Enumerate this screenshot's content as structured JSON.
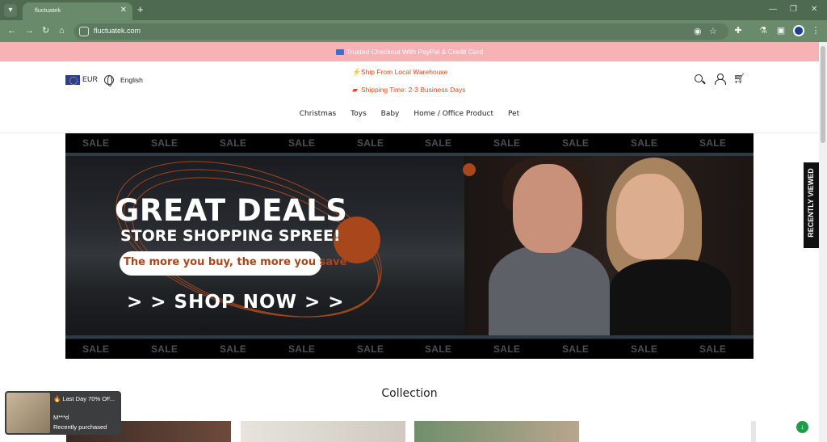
{
  "browser": {
    "tab_title": "fluctuatek",
    "url": "fluctuatek.com",
    "window_controls": [
      "—",
      "❐",
      "✕"
    ]
  },
  "store": {
    "announcement": "Trusted Checkout With PayPal & Credit Card",
    "currency": "EUR",
    "language": "English",
    "promo_lines": [
      "Ship From Local Warehouse",
      "Shipping Time: 2-3 Business Days"
    ],
    "nav": [
      "Christmas",
      "Toys",
      "Baby",
      "Home / Office Product",
      "Pet"
    ],
    "recently_viewed": "RECENTLY VIEWED"
  },
  "banner": {
    "sale_word": "SALE",
    "headline": "GREAT DEALS",
    "subheadline": "STORE SHOPPING SPREE!",
    "tagline": "The more you buy, the more you save",
    "cta": "> >  SHOP NOW  > >"
  },
  "collection": {
    "title": "Collection"
  },
  "popup": {
    "title": "🔥 Last Day 70% OF...",
    "name": "M***d",
    "subtitle": "Recently purchased"
  },
  "colors": {
    "browser_frame": "#4e6b51",
    "announcement_bg": "#f6b2b4",
    "promo_text": "#e24a21",
    "banner_accent": "#a8461c"
  }
}
